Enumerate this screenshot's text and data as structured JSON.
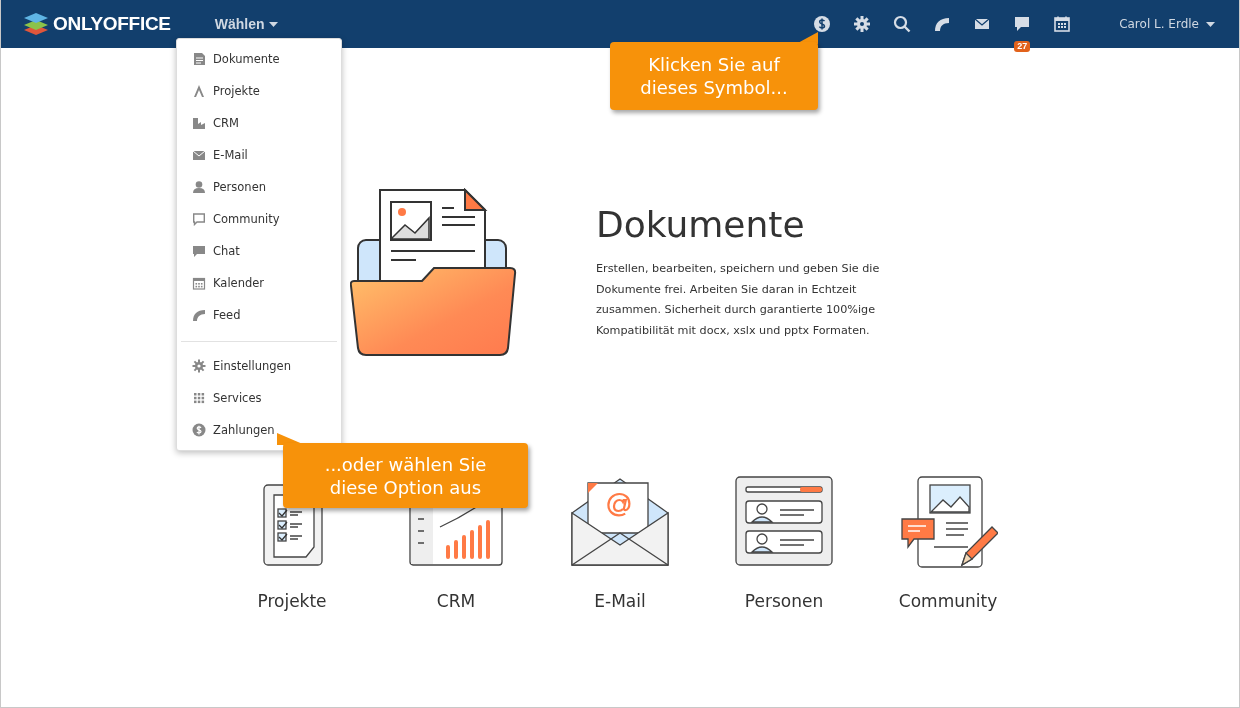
{
  "header": {
    "logo": "ONLYOFFICE",
    "module_switch": {
      "label": "Wählen",
      "expanded": true
    },
    "chat_badge": "27",
    "user": "Carol L. Erdle"
  },
  "menu": {
    "sections": [
      {
        "items": [
          {
            "label": "Dokumente"
          },
          {
            "label": "Projekte"
          },
          {
            "label": "CRM"
          },
          {
            "label": "E-Mail"
          },
          {
            "label": "Personen"
          },
          {
            "label": "Community"
          },
          {
            "label": "Chat"
          },
          {
            "label": "Kalender"
          },
          {
            "label": "Feed"
          }
        ]
      },
      {
        "items": [
          {
            "label": "Einstellungen"
          },
          {
            "label": "Services"
          },
          {
            "label": "Zahlungen"
          }
        ]
      }
    ]
  },
  "hero": {
    "title": "Dokumente",
    "text": "Erstellen, bearbeiten, speichern und geben Sie die Dokumente frei. Arbeiten Sie daran in Echtzeit zusammen. Sicherheit durch garantierte 100%ige Kompatibilität mit docx, xslx und pptx Formaten."
  },
  "modules": [
    {
      "label": "Projekte"
    },
    {
      "label": "CRM"
    },
    {
      "label": "E-Mail"
    },
    {
      "label": "Personen"
    },
    {
      "label": "Community"
    }
  ],
  "callouts": [
    {
      "text": "Klicken Sie auf\ndieses Symbol..."
    },
    {
      "text": "...oder wählen Sie\ndiese Option aus"
    }
  ]
}
